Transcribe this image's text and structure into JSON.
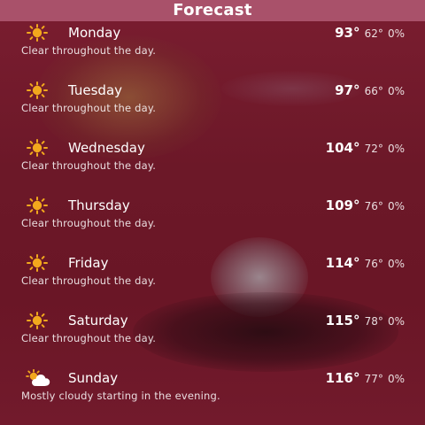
{
  "header": {
    "title": "Forecast"
  },
  "days": [
    {
      "icon": "sun-icon",
      "name": "Monday",
      "high": "93°",
      "low": "62°",
      "precip": "0%",
      "summary": "Clear throughout the day."
    },
    {
      "icon": "sun-icon",
      "name": "Tuesday",
      "high": "97°",
      "low": "66°",
      "precip": "0%",
      "summary": "Clear throughout the day."
    },
    {
      "icon": "sun-icon",
      "name": "Wednesday",
      "high": "104°",
      "low": "72°",
      "precip": "0%",
      "summary": "Clear throughout the day."
    },
    {
      "icon": "sun-icon",
      "name": "Thursday",
      "high": "109°",
      "low": "76°",
      "precip": "0%",
      "summary": "Clear throughout the day."
    },
    {
      "icon": "sun-icon",
      "name": "Friday",
      "high": "114°",
      "low": "76°",
      "precip": "0%",
      "summary": "Clear throughout the day."
    },
    {
      "icon": "sun-icon",
      "name": "Saturday",
      "high": "115°",
      "low": "78°",
      "precip": "0%",
      "summary": "Clear throughout the day."
    },
    {
      "icon": "partly-cloudy-icon",
      "name": "Sunday",
      "high": "116°",
      "low": "77°",
      "precip": "0%",
      "summary": "Mostly cloudy starting in the evening."
    }
  ],
  "colors": {
    "header_bg": "#a9516a",
    "background": "#6e1a2a",
    "sun": "#f2a81d"
  }
}
